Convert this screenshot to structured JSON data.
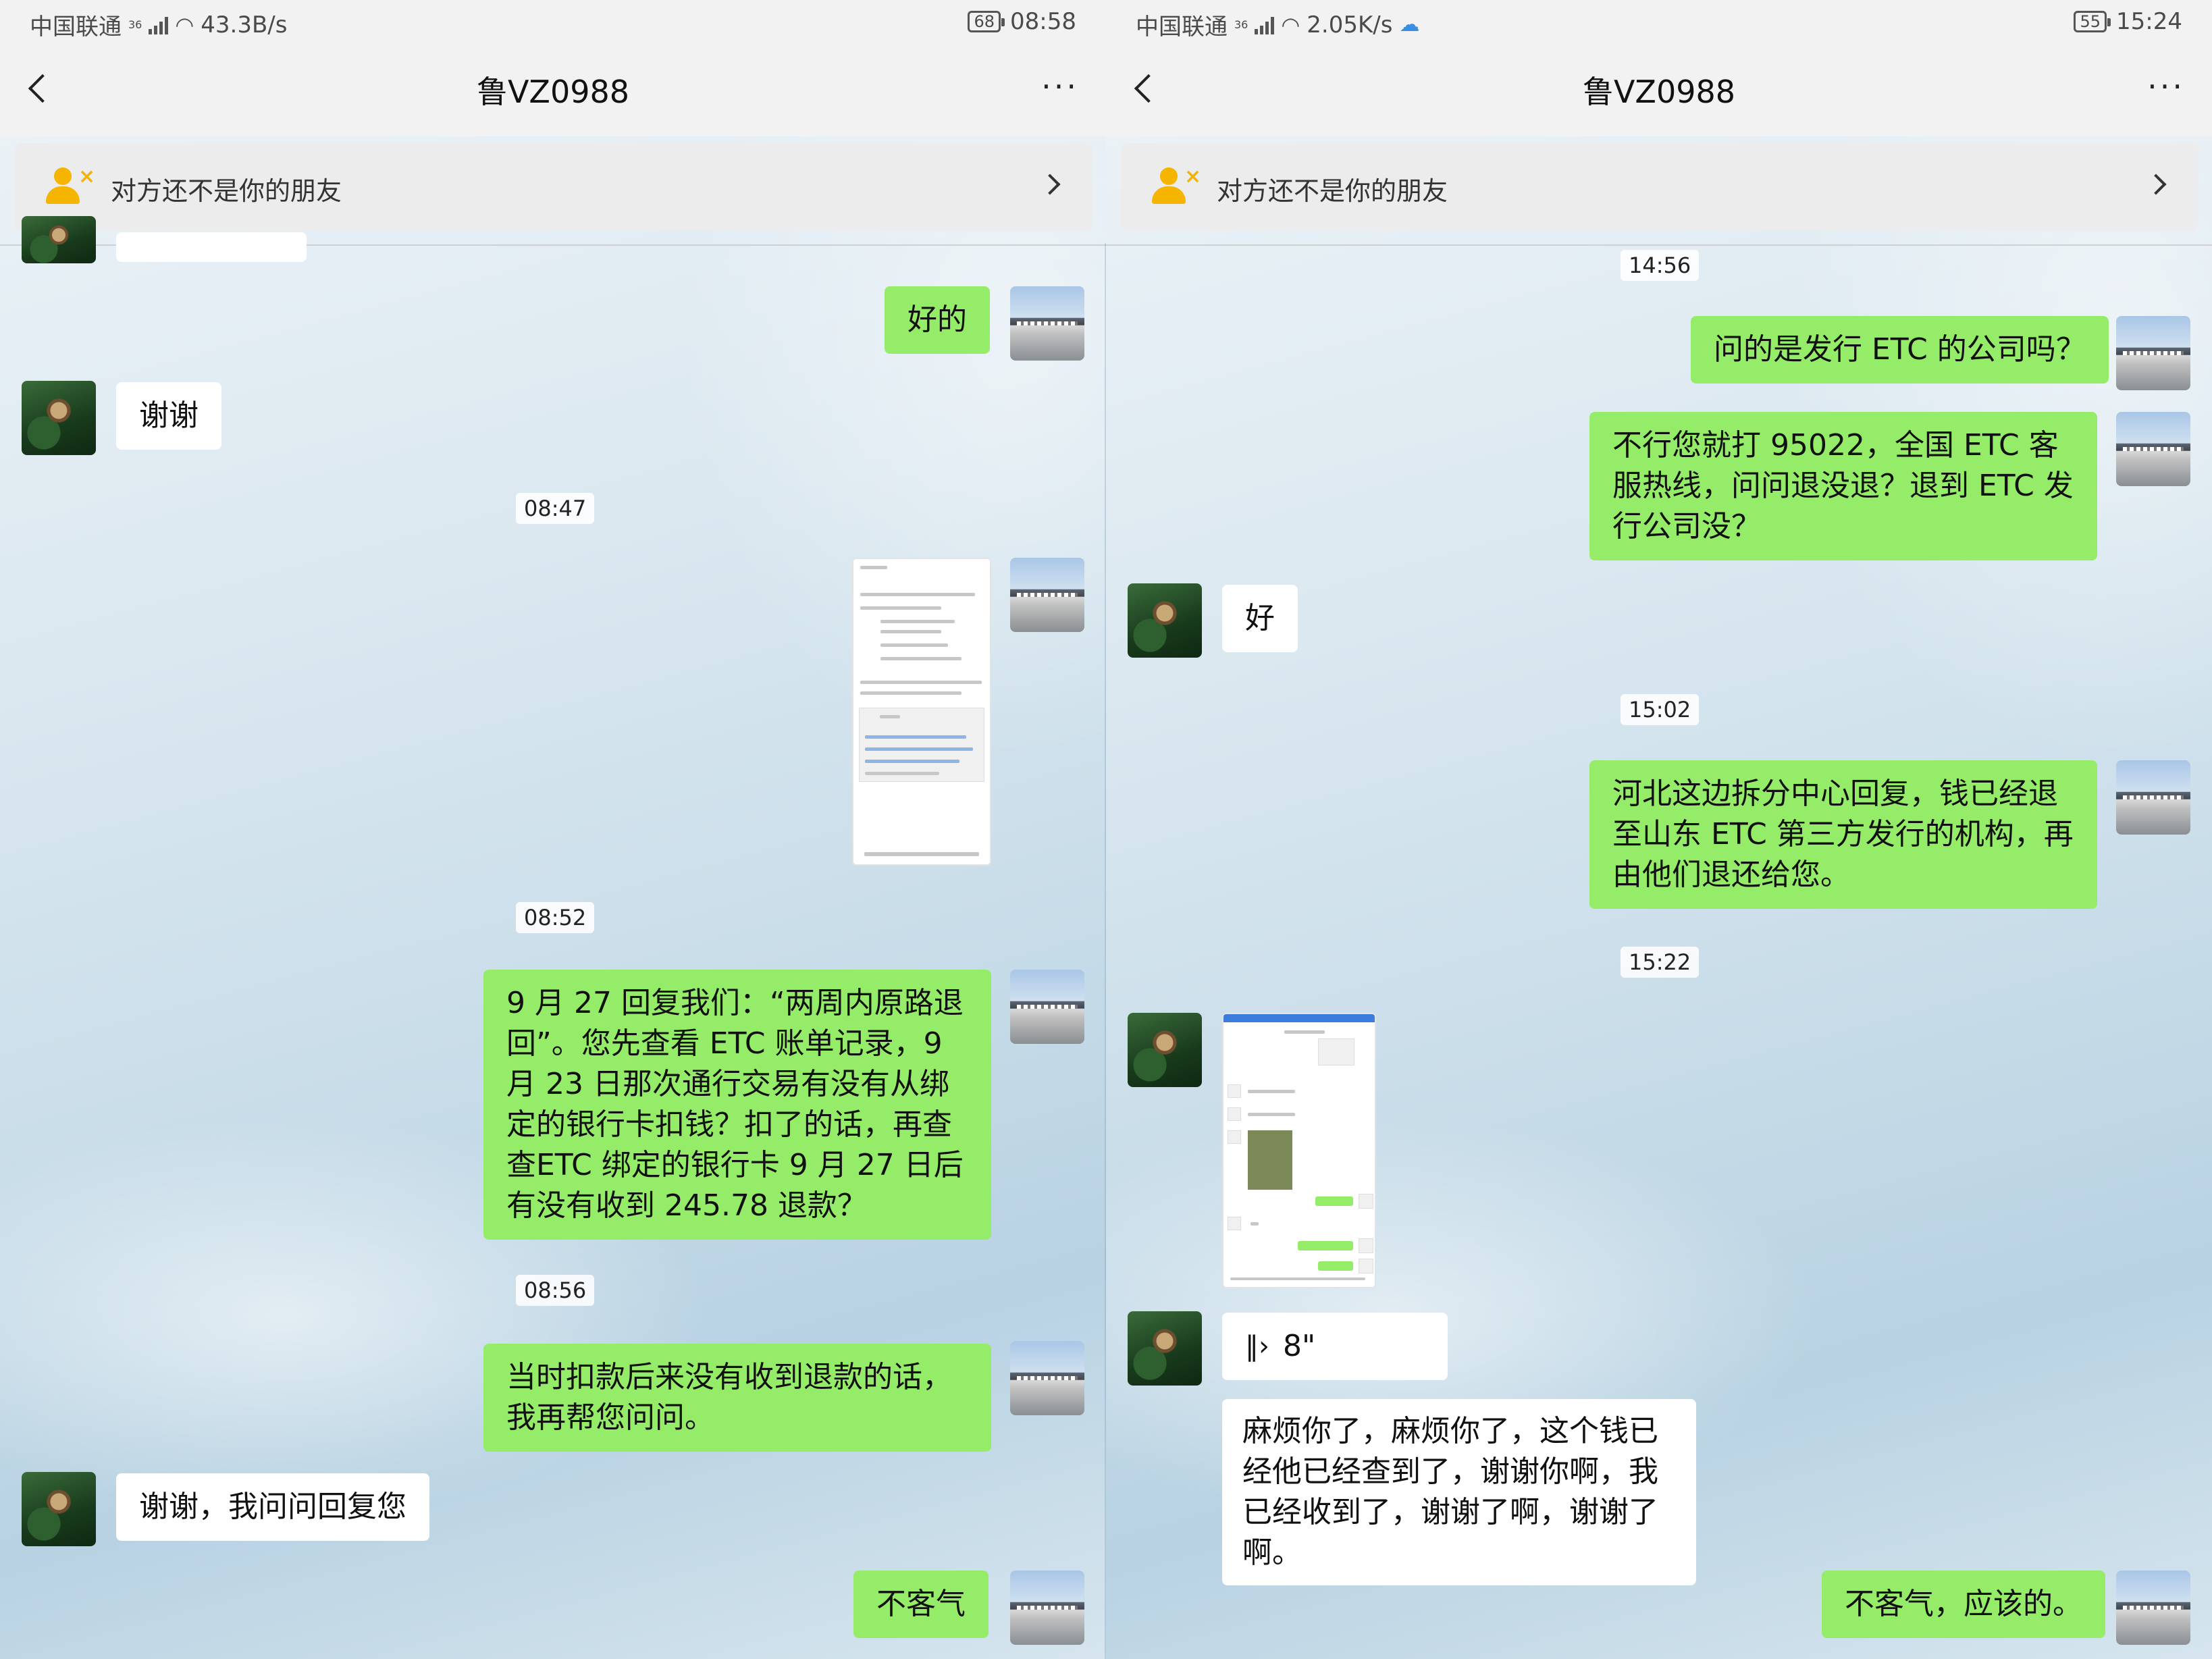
{
  "left": {
    "status": {
      "carrier": "中国联通",
      "net": "36",
      "speed": "43.3B/s",
      "battery": "68",
      "time": "08:58"
    },
    "nav": {
      "title": "鲁VZ0988"
    },
    "notice": {
      "text": "对方还不是你的朋友"
    },
    "messages": {
      "m1": "好的",
      "m2": "谢谢",
      "t1": "08:47",
      "t2": "08:52",
      "m3": "9 月 27 回复我们：“两周内原路退回”。您先查看 ETC 账单记录，9 月 23 日那次通行交易有没有从绑定的银行卡扣钱？扣了的话，再查查ETC 绑定的银行卡 9 月 27 日后有没有收到 245.78 退款？",
      "t3": "08:56",
      "m4": "当时扣款后来没有收到退款的话，我再帮您问问。",
      "m5": "谢谢，我问问回复您",
      "m6": "不客气"
    }
  },
  "right": {
    "status": {
      "carrier": "中国联通",
      "net": "36",
      "speed": "2.05K/s",
      "battery": "55",
      "time": "15:24"
    },
    "nav": {
      "title": "鲁VZ0988"
    },
    "notice": {
      "text": "对方还不是你的朋友"
    },
    "messages": {
      "t1": "14:56",
      "m1": "问的是发行 ETC 的公司吗？",
      "m2": "不行您就打 95022，全国 ETC 客服热线，问问退没退？退到 ETC 发行公司没？",
      "m3": "好",
      "t2": "15:02",
      "m4": "河北这边拆分中心回复，钱已经退至山东 ETC 第三方发行的机构，再由他们退还给您。",
      "t3": "15:22",
      "voice_duration": "8\"",
      "m5": "麻烦你了，麻烦你了，这个钱已经他已经查到了，谢谢你啊，我已经收到了，谢谢了啊，谢谢了啊。",
      "m6": "不客气，应该的。"
    }
  }
}
